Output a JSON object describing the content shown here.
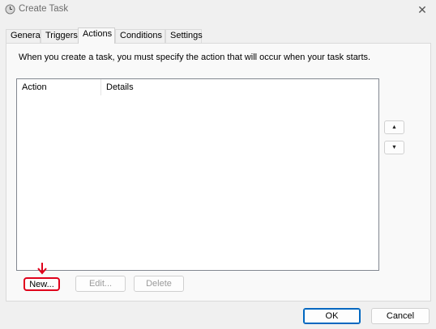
{
  "window": {
    "title": "Create Task",
    "close_glyph": "✕"
  },
  "tabs": [
    {
      "label": "General"
    },
    {
      "label": "Triggers"
    },
    {
      "label": "Actions",
      "active": true
    },
    {
      "label": "Conditions"
    },
    {
      "label": "Settings"
    }
  ],
  "actions_tab": {
    "instruction": "When you create a task, you must specify the action that will occur when your task starts.",
    "columns": {
      "action": "Action",
      "details": "Details"
    },
    "rows": [],
    "move_up_glyph": "▲",
    "move_down_glyph": "▼",
    "buttons": {
      "new": "New...",
      "edit": "Edit...",
      "delete": "Delete"
    }
  },
  "footer": {
    "ok": "OK",
    "cancel": "Cancel"
  },
  "colors": {
    "highlight": "#e0001b",
    "accent": "#0067c0"
  }
}
